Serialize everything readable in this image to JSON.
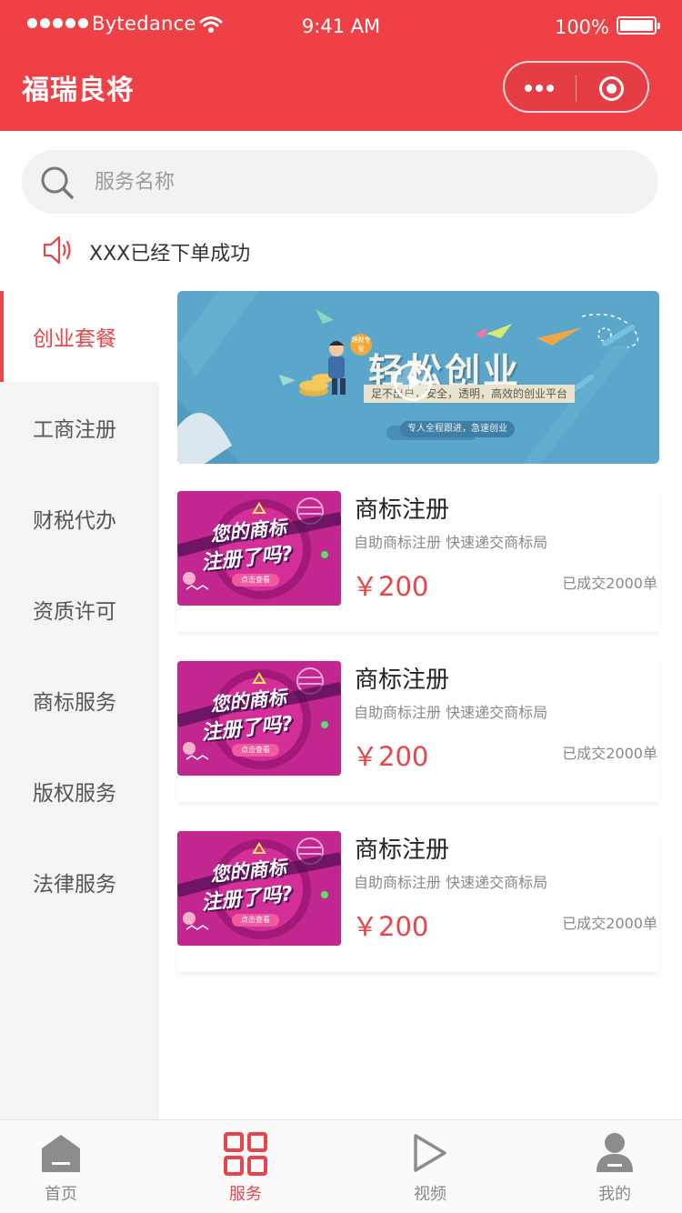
{
  "status_bar": {
    "carrier": "Bytedance",
    "time": "9:41 AM",
    "battery": "100%"
  },
  "nav": {
    "title": "福瑞良将"
  },
  "search": {
    "placeholder": "服务名称"
  },
  "notice": {
    "text": "XXX已经下单成功"
  },
  "sidebar": {
    "items": [
      {
        "label": "创业套餐",
        "active": true
      },
      {
        "label": "工商注册"
      },
      {
        "label": "财税代办"
      },
      {
        "label": "资质许可"
      },
      {
        "label": "商标服务"
      },
      {
        "label": "版权服务"
      },
      {
        "label": "法律服务"
      }
    ]
  },
  "banner": {
    "title": "轻松创业",
    "subtitle": "足不出户，安全，透明，高效的创业平台",
    "caption": "专人全程跟进，急速创业",
    "badge": "理财专家",
    "background": "#5aa7cb"
  },
  "products": [
    {
      "name": "商标注册",
      "desc": "自助商标注册 快速递交商标局",
      "price": "￥200",
      "sold": "已成交2000单",
      "thumb_line1": "您的商标",
      "thumb_line2": "注册了吗?",
      "thumb_tag": "点击查看"
    },
    {
      "name": "商标注册",
      "desc": "自助商标注册 快速递交商标局",
      "price": "￥200",
      "sold": "已成交2000单",
      "thumb_line1": "您的商标",
      "thumb_line2": "注册了吗?",
      "thumb_tag": "点击查看"
    },
    {
      "name": "商标注册",
      "desc": "自助商标注册 快速递交商标局",
      "price": "￥200",
      "sold": "已成交2000单",
      "thumb_line1": "您的商标",
      "thumb_line2": "注册了吗?",
      "thumb_tag": "点击查看"
    }
  ],
  "tabbar": {
    "items": [
      {
        "label": "首页",
        "icon": "home-icon"
      },
      {
        "label": "服务",
        "icon": "grid-icon",
        "active": true
      },
      {
        "label": "视频",
        "icon": "play-icon"
      },
      {
        "label": "我的",
        "icon": "user-icon"
      }
    ]
  },
  "colors": {
    "brand": "#ef4046",
    "accent": "#e8454a",
    "sidebar_bg": "#f4f4f4",
    "thumb_bg": "#c2268f"
  }
}
